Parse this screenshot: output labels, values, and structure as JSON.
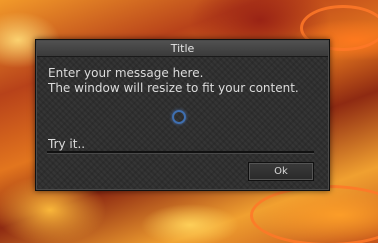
{
  "window": {
    "title": "Title",
    "message_lines": [
      "Enter your message here.",
      "The window will resize to fit your content."
    ],
    "input": {
      "value": "Try it..",
      "placeholder": ""
    },
    "ok_label": "Ok"
  },
  "colors": {
    "window_bg": "#2c2c2c",
    "titlebar_text": "#e6e6e6",
    "body_text": "#dcdcdc",
    "spinner_accent": "#3f6fb0"
  },
  "icons": {
    "loading": "loading-spinner-icon"
  }
}
